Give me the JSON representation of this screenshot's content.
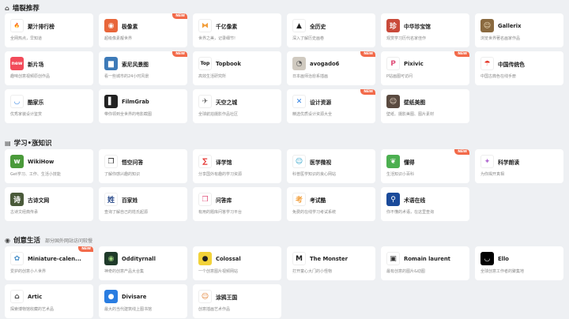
{
  "sections": [
    {
      "title": "墙裂推荐",
      "icon": "home-icon",
      "cards": [
        {
          "name": "聚汁排行榜",
          "desc": "全网热点，早知道",
          "badge": "",
          "logo": "fire-icon",
          "logo_bg": "#ffffff",
          "logo_fg": "#e53935",
          "logo_text": "🔥"
        },
        {
          "name": "极像素",
          "desc": "超级像素靓世界",
          "badge": "NEW",
          "logo": "lens-icon",
          "logo_bg": "#e8663a",
          "logo_fg": "#ffffff",
          "logo_text": "◉"
        },
        {
          "name": "千亿像素",
          "desc": "世界之美，记录细节!",
          "badge": "",
          "logo": "bowtie-icon",
          "logo_bg": "#ffffff",
          "logo_fg": "#f29f3d",
          "logo_text": "⧓"
        },
        {
          "name": "全历史",
          "desc": "深入了解历史画卷",
          "badge": "",
          "logo": "mountain-icon",
          "logo_bg": "#ffffff",
          "logo_fg": "#222222",
          "logo_text": "▲"
        },
        {
          "name": "中华珍宝馆",
          "desc": "观赏学习历代名家佳作",
          "badge": "",
          "logo": "seal-icon",
          "logo_bg": "#c94a3a",
          "logo_fg": "#ffffff",
          "logo_text": "珍"
        },
        {
          "name": "Gallerix",
          "desc": "浏览世界著名画家作品",
          "badge": "",
          "logo": "portrait-icon",
          "logo_bg": "#8a6a40",
          "logo_fg": "#f3e2c0",
          "logo_text": "☺"
        },
        {
          "name": "新片场",
          "desc": "趣味创意视频原创作品",
          "badge": "",
          "logo": "new-logo-icon",
          "logo_bg": "#f24b5a",
          "logo_fg": "#ffffff",
          "logo_text": "new"
        },
        {
          "name": "索尼风景图",
          "desc": "看一些城市的24小时风景",
          "badge": "NEW",
          "logo": "landscape-icon",
          "logo_bg": "#3d7ab8",
          "logo_fg": "#ffffff",
          "logo_text": "▆"
        },
        {
          "name": "Topbook",
          "desc": "高效生活研究所",
          "badge": "",
          "logo": "topbook-icon",
          "logo_bg": "#ffffff",
          "logo_fg": "#111111",
          "logo_text": "Top"
        },
        {
          "name": "avogado6",
          "desc": "日本画师治愈系插画",
          "badge": "NEW",
          "logo": "illustration-icon",
          "logo_bg": "#d0cac0",
          "logo_fg": "#555555",
          "logo_text": "◔"
        },
        {
          "name": "Pixivic",
          "desc": "P站画图可访问",
          "badge": "NEW",
          "logo": "pixivic-icon",
          "logo_bg": "#ffffff",
          "logo_fg": "#e0507a",
          "logo_text": "P"
        },
        {
          "name": "中国传统色",
          "desc": "中国古典色在线手册",
          "badge": "",
          "logo": "umbrella-icon",
          "logo_bg": "#ffffff",
          "logo_fg": "#e5392a",
          "logo_text": "☂"
        },
        {
          "name": "酷家乐",
          "desc": "优秀家装设计鉴赏",
          "badge": "",
          "logo": "smile-icon",
          "logo_bg": "#ffffff",
          "logo_fg": "#2a7de1",
          "logo_text": "◡"
        },
        {
          "name": "FilmGrab",
          "desc": "带你领到全世界的电影截图",
          "badge": "",
          "logo": "film-icon",
          "logo_bg": "#222222",
          "logo_fg": "#ffffff",
          "logo_text": "▌"
        },
        {
          "name": "天空之城",
          "desc": "全球航拍摄影作品社区",
          "badge": "",
          "logo": "drone-icon",
          "logo_bg": "#ffffff",
          "logo_fg": "#666666",
          "logo_text": "✈"
        },
        {
          "name": "设计资源",
          "desc": "精选优质设计资源大全",
          "badge": "NEW",
          "logo": "design-icon",
          "logo_bg": "#ffffff",
          "logo_fg": "#2a7de1",
          "logo_text": "✕"
        },
        {
          "name": "壁纸美图",
          "desc": "壁纸、摄影美图、图片素材",
          "badge": "",
          "logo": "wallpaper-icon",
          "logo_bg": "#5a4a40",
          "logo_fg": "#f0e0d0",
          "logo_text": "☺"
        }
      ]
    },
    {
      "title": "学习•涨知识",
      "icon": "book-icon",
      "cards": [
        {
          "name": "WikiHow",
          "desc": "Get学习、工作、生活小技能",
          "badge": "",
          "logo": "wikihow-icon",
          "logo_bg": "#4a9a3a",
          "logo_fg": "#ffffff",
          "logo_text": "w"
        },
        {
          "name": "悟空问答",
          "desc": "了解你感兴趣的知识",
          "badge": "",
          "logo": "qa-icon",
          "logo_bg": "#ffffff",
          "logo_fg": "#222222",
          "logo_text": "❐"
        },
        {
          "name": "译学馆",
          "desc": "分享国外有趣的学习资源",
          "badge": "",
          "logo": "translate-icon",
          "logo_bg": "#ffffff",
          "logo_fg": "#e53935",
          "logo_text": "∑"
        },
        {
          "name": "医学微视",
          "desc": "科普医学知识的良心网站",
          "badge": "",
          "logo": "medical-icon",
          "logo_bg": "#ffffff",
          "logo_fg": "#2aa0c8",
          "logo_text": "☺"
        },
        {
          "name": "懂得",
          "desc": "生活知识小百科",
          "badge": "NEW",
          "logo": "leaf-icon",
          "logo_bg": "#4caf50",
          "logo_fg": "#ffffff",
          "logo_text": "❦"
        },
        {
          "name": "科学朗读",
          "desc": "为你揭开真相",
          "badge": "",
          "logo": "bird-icon",
          "logo_bg": "#ffffff",
          "logo_fg": "#b069d1",
          "logo_text": "✦"
        },
        {
          "name": "古诗文网",
          "desc": "古诗文经典传承",
          "badge": "",
          "logo": "poem-icon",
          "logo_bg": "#4a5a3a",
          "logo_fg": "#ffffff",
          "logo_text": "诗"
        },
        {
          "name": "百家姓",
          "desc": "查询了解自己的姓氏起源",
          "badge": "",
          "logo": "surname-icon",
          "logo_bg": "#ffffff",
          "logo_fg": "#2a4a8a",
          "logo_text": "姓"
        },
        {
          "name": "问答库",
          "desc": "有用的题库问答学习平台",
          "badge": "",
          "logo": "question-bank-icon",
          "logo_bg": "#ffffff",
          "logo_fg": "#e0507a",
          "logo_text": "❒"
        },
        {
          "name": "考试酷",
          "desc": "免费的在线学习考试系统",
          "badge": "",
          "logo": "exam-icon",
          "logo_bg": "#ffffff",
          "logo_fg": "#f29f3d",
          "logo_text": "考"
        },
        {
          "name": "术语在线",
          "desc": "你不懂的术语，在这里查询",
          "badge": "",
          "logo": "term-icon",
          "logo_bg": "#1a4a9a",
          "logo_fg": "#ffffff",
          "logo_text": "⚲"
        }
      ]
    },
    {
      "title": "创意生活",
      "subtitle": "部分国外网站访问较慢",
      "icon": "eye-icon",
      "cards": [
        {
          "name": "Miniature-calen...",
          "desc": "爱护的创意小人世界",
          "badge": "NEW",
          "logo": "miniature-icon",
          "logo_bg": "#ffffff",
          "logo_fg": "#4a90c8",
          "logo_text": "✿"
        },
        {
          "name": "Oddityrnall",
          "desc": "神奇的创意产品大合集",
          "badge": "",
          "logo": "oddity-icon",
          "logo_bg": "#1f3a2a",
          "logo_fg": "#9ad07a",
          "logo_text": "◉"
        },
        {
          "name": "Colossal",
          "desc": "一个创意图片视频网站",
          "badge": "",
          "logo": "colossal-icon",
          "logo_bg": "#f2d23a",
          "logo_fg": "#222222",
          "logo_text": "●"
        },
        {
          "name": "The Monster",
          "desc": "打开童心大门的小怪物",
          "badge": "",
          "logo": "monster-icon",
          "logo_bg": "#ffffff",
          "logo_fg": "#222222",
          "logo_text": "M"
        },
        {
          "name": "Romain laurent",
          "desc": "最有创意的图片&动图",
          "badge": "",
          "logo": "photo-icon",
          "logo_bg": "#ffffff",
          "logo_fg": "#333333",
          "logo_text": "▣"
        },
        {
          "name": "Ello",
          "desc": "全球创意工作者的聚集地",
          "badge": "",
          "logo": "ello-icon",
          "logo_bg": "#000000",
          "logo_fg": "#ffffff",
          "logo_text": "◡"
        },
        {
          "name": "Artic",
          "desc": "探索博物馆收藏的艺术品",
          "badge": "",
          "logo": "artic-icon",
          "logo_bg": "#ffffff",
          "logo_fg": "#444444",
          "logo_text": "⌂"
        },
        {
          "name": "Divisare",
          "desc": "最大的当代建筑线上图书馆",
          "badge": "",
          "logo": "divisare-icon",
          "logo_bg": "#2a7de1",
          "logo_fg": "#ffffff",
          "logo_text": "●"
        },
        {
          "name": "涂鸦王国",
          "desc": "创意插画艺术作品",
          "badge": "",
          "logo": "graffiti-icon",
          "logo_bg": "#ffffff",
          "logo_fg": "#e07a2a",
          "logo_text": "☺"
        }
      ]
    }
  ]
}
